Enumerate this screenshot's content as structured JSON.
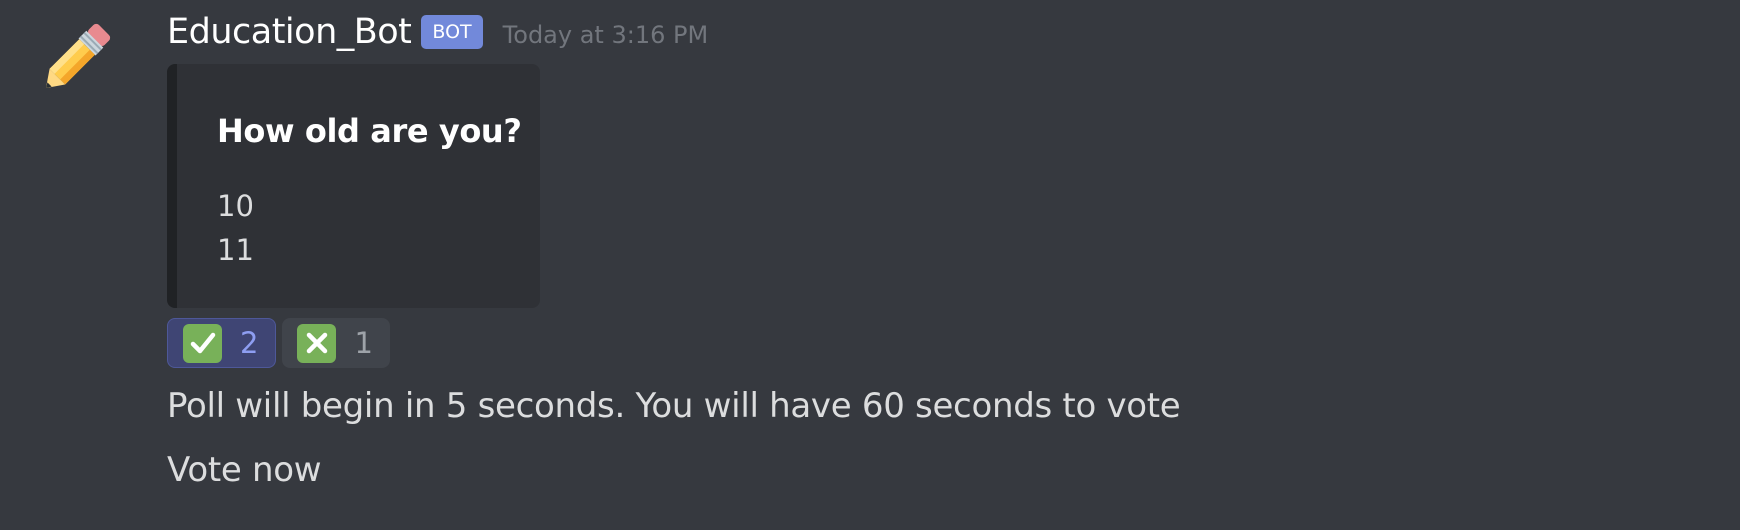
{
  "message": {
    "author": {
      "username": "Education_Bot",
      "bot_tag": "BOT",
      "avatar_icon": "pencil-icon"
    },
    "timestamp": "Today at 3:16 PM",
    "embed": {
      "title": "How old are you?",
      "lines": [
        "10",
        "11"
      ]
    },
    "reactions": [
      {
        "icon": "check-mark-icon",
        "count": "2",
        "active": true,
        "color": "#78b159"
      },
      {
        "icon": "cross-mark-icon",
        "count": "1",
        "active": false,
        "color": "#78b159"
      }
    ],
    "content": [
      "Poll will begin in 5 seconds. You will have 60 seconds to vote",
      "Vote now"
    ]
  },
  "colors": {
    "background": "#36393f",
    "embed_background": "#2f3136",
    "bot_tag": "#7289da",
    "reaction_active": "#3f4574"
  }
}
